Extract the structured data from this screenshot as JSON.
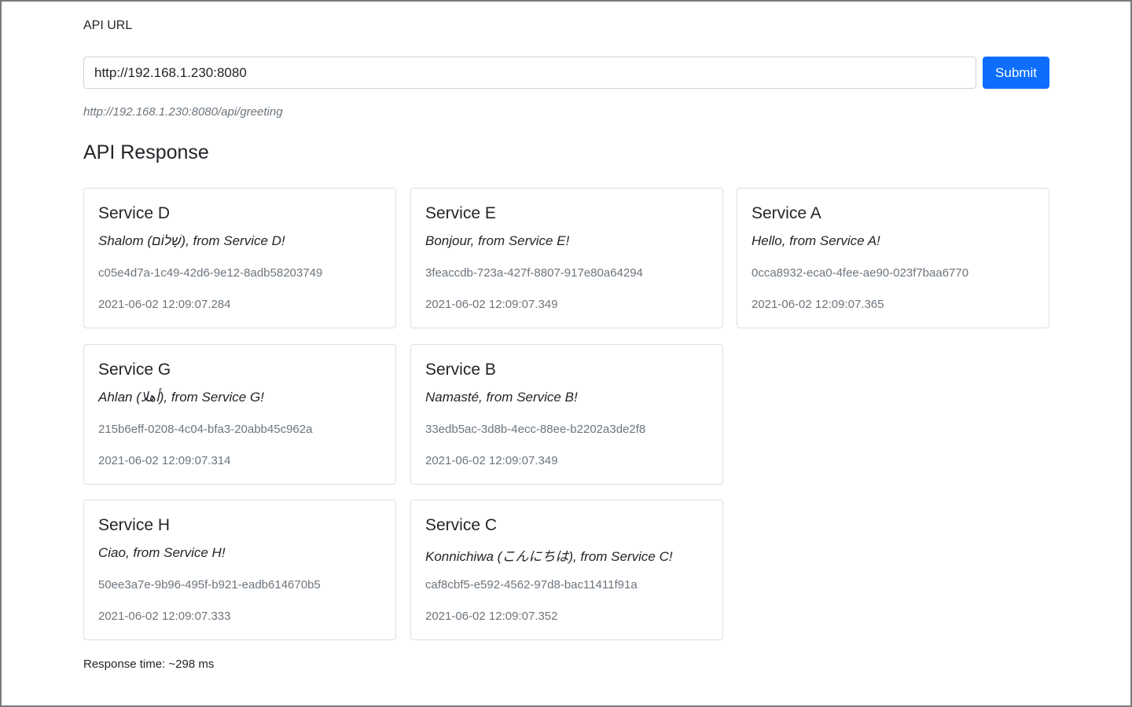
{
  "form": {
    "label": "API URL",
    "url_value": "http://192.168.1.230:8080",
    "submit_label": "Submit",
    "endpoint": "http://192.168.1.230:8080/api/greeting"
  },
  "response": {
    "title": "API Response",
    "cards": [
      {
        "service": "Service D",
        "message": "Shalom (שָׁלוֹם), from Service D!",
        "id": "c05e4d7a-1c49-42d6-9e12-8adb58203749",
        "timestamp": "2021-06-02 12:09:07.284"
      },
      {
        "service": "Service E",
        "message": "Bonjour, from Service E!",
        "id": "3feaccdb-723a-427f-8807-917e80a64294",
        "timestamp": "2021-06-02 12:09:07.349"
      },
      {
        "service": "Service A",
        "message": "Hello, from Service A!",
        "id": "0cca8932-eca0-4fee-ae90-023f7baa6770",
        "timestamp": "2021-06-02 12:09:07.365"
      },
      {
        "service": "Service G",
        "message": "Ahlan (أهلا), from Service G!",
        "id": "215b6eff-0208-4c04-bfa3-20abb45c962a",
        "timestamp": "2021-06-02 12:09:07.314"
      },
      {
        "service": "Service B",
        "message": "Namasté, from Service B!",
        "id": "33edb5ac-3d8b-4ecc-88ee-b2202a3de2f8",
        "timestamp": "2021-06-02 12:09:07.349"
      },
      {
        "service": "Service H",
        "message": "Ciao, from Service H!",
        "id": "50ee3a7e-9b96-495f-b921-eadb614670b5",
        "timestamp": "2021-06-02 12:09:07.333"
      },
      {
        "service": "Service C",
        "message": "Konnichiwa (こんにちは), from Service C!",
        "id": "caf8cbf5-e592-4562-97d8-bac11411f91a",
        "timestamp": "2021-06-02 12:09:07.352"
      }
    ],
    "response_time": "Response time: ~298 ms"
  },
  "colors": {
    "primary": "#0d6efd",
    "muted_text": "#6c757d",
    "card_border": "#dfdfdf"
  }
}
